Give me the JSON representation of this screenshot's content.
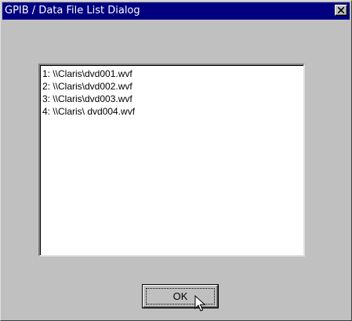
{
  "window": {
    "title": "GPIB / Data File List Dialog"
  },
  "titlebar": {
    "close_icon": "close-icon"
  },
  "file_list": {
    "items": [
      "1: \\\\Claris\\dvd001.wvf",
      "2: \\\\Claris\\dvd002.wvf",
      "3: \\\\Claris\\dvd003.wvf",
      "4: \\\\Claris\\ dvd004.wvf"
    ]
  },
  "buttons": {
    "ok_label": "OK"
  },
  "colors": {
    "titlebar": "#000080",
    "face": "#c0c0c0",
    "list_bg": "#ffffff"
  }
}
